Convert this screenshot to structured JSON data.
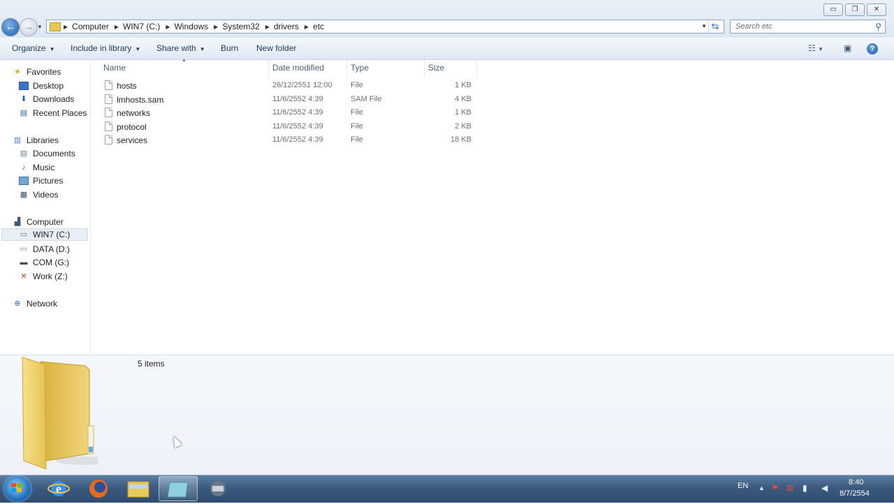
{
  "window": {
    "controls": {
      "minimize": "▭",
      "restore": "❐",
      "close": "✕"
    }
  },
  "address_bar": {
    "crumbs": [
      "Computer",
      "WIN7 (C:)",
      "Windows",
      "System32",
      "drivers",
      "etc"
    ]
  },
  "search": {
    "placeholder": "Search etc"
  },
  "toolbar": {
    "organize": "Organize",
    "include_in_library": "Include in library",
    "share_with": "Share with",
    "burn": "Burn",
    "new_folder": "New folder"
  },
  "nav": {
    "favorites": {
      "label": "Favorites",
      "items": [
        "Desktop",
        "Downloads",
        "Recent Places"
      ]
    },
    "libraries": {
      "label": "Libraries",
      "items": [
        "Documents",
        "Music",
        "Pictures",
        "Videos"
      ]
    },
    "computer": {
      "label": "Computer",
      "items": [
        "WIN7 (C:)",
        "DATA (D:)",
        "COM (G:)",
        "Work (Z:)"
      ],
      "selected": "WIN7 (C:)"
    },
    "network": {
      "label": "Network"
    }
  },
  "columns": {
    "name": "Name",
    "date": "Date modified",
    "type": "Type",
    "size": "Size"
  },
  "files": [
    {
      "name": "hosts",
      "date": "26/12/2551 12:00",
      "type": "File",
      "size": "1 KB"
    },
    {
      "name": "lmhosts.sam",
      "date": "11/6/2552 4:39",
      "type": "SAM File",
      "size": "4 KB"
    },
    {
      "name": "networks",
      "date": "11/6/2552 4:39",
      "type": "File",
      "size": "1 KB"
    },
    {
      "name": "protocol",
      "date": "11/6/2552 4:39",
      "type": "File",
      "size": "2 KB"
    },
    {
      "name": "services",
      "date": "11/6/2552 4:39",
      "type": "File",
      "size": "18 KB"
    }
  ],
  "details": {
    "item_count": "5 items"
  },
  "taskbar": {
    "language": "EN",
    "time": "8:40",
    "date": "8/7/2554"
  }
}
